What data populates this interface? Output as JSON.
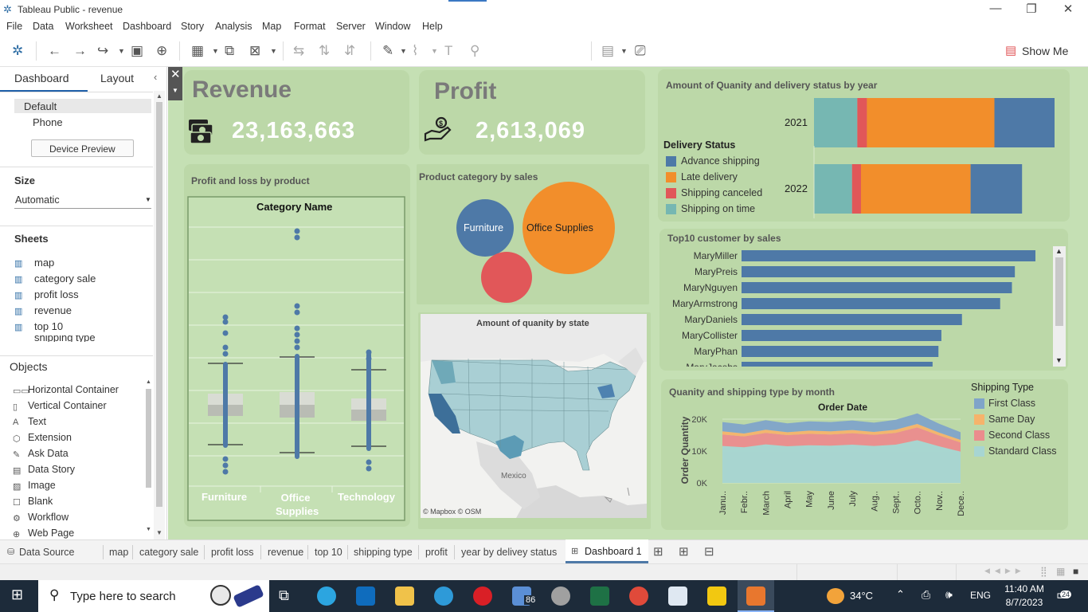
{
  "window": {
    "title": "Tableau Public - revenue",
    "min_label": "—",
    "max_label": "❐",
    "close_label": "✕"
  },
  "menu": [
    "File",
    "Data",
    "Worksheet",
    "Dashboard",
    "Story",
    "Analysis",
    "Map",
    "Format",
    "Server",
    "Window",
    "Help"
  ],
  "toolbar": {
    "show_me_label": "Show Me"
  },
  "left_pane": {
    "tabs": {
      "dashboard": "Dashboard",
      "layout": "Layout"
    },
    "device": {
      "default": "Default",
      "phone": "Phone",
      "preview_button": "Device Preview"
    },
    "size": {
      "heading": "Size",
      "value": "Automatic"
    },
    "sheets": {
      "heading": "Sheets",
      "items": [
        "map",
        "category sale",
        "profit loss",
        "revenue",
        "top 10",
        "shipping type"
      ]
    },
    "objects": {
      "heading": "Objects",
      "items": [
        "Horizontal Container",
        "Vertical Container",
        "Text",
        "Extension",
        "Ask Data",
        "Data Story",
        "Image",
        "Blank",
        "Workflow",
        "Web Page"
      ]
    }
  },
  "dashboard": {
    "revenue": {
      "title": "Revenue",
      "value": "23,163,663"
    },
    "profit": {
      "title": "Profit",
      "value": "2,613,069"
    },
    "profit_loss": {
      "title": "Profit and loss by product",
      "header": "Category Name",
      "categories": [
        "Furniture",
        "Office Supplies",
        "Technology"
      ]
    },
    "category_sales": {
      "title": "Product category by sales",
      "labels": [
        "Furniture",
        "Office Supplies"
      ]
    },
    "map": {
      "title": "Amount of quanity by state",
      "country_label": "Mexico",
      "attribution": "© Mapbox © OSM"
    },
    "delivery": {
      "title": "Amount of Quanity and delivery status by year",
      "legend_title": "Delivery Status",
      "legend": [
        "Advance shipping",
        "Late delivery",
        "Shipping canceled",
        "Shipping on time"
      ],
      "colors": [
        "#4e79a7",
        "#f28e2b",
        "#e15759",
        "#76b7b2"
      ]
    },
    "top10": {
      "title": "Top10 customer by sales"
    },
    "shipping": {
      "title": "Quanity and shipping type by month",
      "header": "Order Date",
      "ylabel": "Order Quantity",
      "legend_title": "Shipping Type",
      "legend": [
        "First Class",
        "Same Day",
        "Second Class",
        "Standard Class"
      ],
      "colors": [
        "#4e79a7",
        "#f28e2b",
        "#e15759",
        "#8cc6c3"
      ]
    }
  },
  "chart_data": [
    {
      "type": "bar",
      "title": "Amount of Quanity and delivery status by year",
      "categories": [
        "2021",
        "2022"
      ],
      "stacked": true,
      "series": [
        {
          "name": "Shipping on time",
          "values": [
            0.18,
            0.17
          ]
        },
        {
          "name": "Shipping canceled",
          "values": [
            0.04,
            0.04
          ]
        },
        {
          "name": "Late delivery",
          "values": [
            0.53,
            0.49
          ]
        },
        {
          "name": "Advance shipping",
          "values": [
            0.25,
            0.23
          ]
        }
      ]
    },
    {
      "type": "bar",
      "title": "Top10 customer by sales",
      "orientation": "horizontal",
      "categories": [
        "MaryMiller",
        "MaryPreis",
        "MaryNguyen",
        "MaryArmstrong",
        "MaryDaniels",
        "MaryCollister",
        "MaryPhan",
        "MaryJacobs"
      ],
      "values": [
        1.0,
        0.93,
        0.92,
        0.88,
        0.75,
        0.68,
        0.67,
        0.65
      ]
    },
    {
      "type": "area",
      "title": "Quanity and shipping type by month",
      "xlabel": "Order Date",
      "ylabel": "Order Quantity",
      "ylim": [
        0,
        22000
      ],
      "yticks": [
        "0K",
        "10K",
        "20K"
      ],
      "ytick_values": [
        0,
        10000,
        20000
      ],
      "categories": [
        "Janu..",
        "Febr..",
        "March",
        "April",
        "May",
        "June",
        "July",
        "Aug..",
        "Sept..",
        "Octo..",
        "Nov..",
        "Dece.."
      ],
      "series": [
        {
          "name": "Standard Class",
          "values": [
            11600,
            11200,
            12100,
            11500,
            11800,
            11700,
            12000,
            11600,
            12000,
            13400,
            11500,
            9800
          ]
        },
        {
          "name": "Second Class",
          "values": [
            3600,
            3400,
            3600,
            3500,
            3600,
            3500,
            3600,
            3500,
            3700,
            4000,
            3400,
            2900
          ]
        },
        {
          "name": "Same Day",
          "values": [
            1000,
            900,
            1000,
            900,
            1000,
            1000,
            1000,
            900,
            1000,
            1100,
            900,
            800
          ]
        },
        {
          "name": "First Class",
          "values": [
            2900,
            2800,
            3000,
            2800,
            2900,
            2900,
            3000,
            2900,
            3100,
            3300,
            2800,
            2400
          ]
        }
      ]
    }
  ],
  "tabs": [
    "Data Source",
    "map",
    "category sale",
    "profit loss",
    "revenue",
    "top 10",
    "shipping type",
    "profit",
    "year by delivey status",
    "Dashboard 1"
  ],
  "taskbar": {
    "search_placeholder": "Type here to search",
    "weather": "34°C",
    "lang": "ENG",
    "time": "11:40 AM",
    "date": "8/7/2023",
    "mail_badge": "86",
    "notif_badge": "24"
  }
}
